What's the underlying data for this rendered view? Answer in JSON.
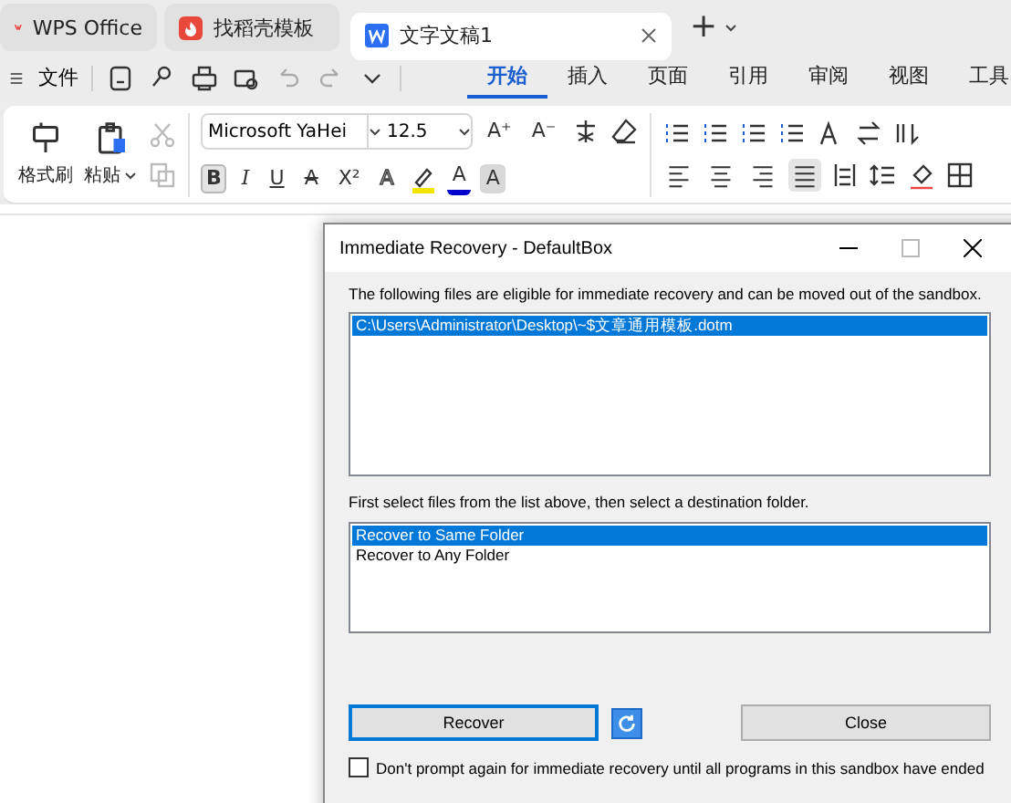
{
  "app_tabs": [
    {
      "label": "WPS Office",
      "kind": "home",
      "selected": false
    },
    {
      "label": "找稻壳模板",
      "kind": "template",
      "selected": false
    },
    {
      "label": "文字文稿1",
      "kind": "doc",
      "selected": true
    }
  ],
  "new_tab": "+",
  "file_menu": "文件",
  "menu_tabs": [
    {
      "label": "开始",
      "selected": true
    },
    {
      "label": "插入",
      "selected": false
    },
    {
      "label": "页面",
      "selected": false
    },
    {
      "label": "引用",
      "selected": false
    },
    {
      "label": "审阅",
      "selected": false
    },
    {
      "label": "视图",
      "selected": false
    },
    {
      "label": "工具",
      "selected": false
    }
  ],
  "ribbon": {
    "format_painter": "格式刷",
    "paste": "粘贴",
    "font_name": "Microsoft YaHei",
    "font_size": "12.5",
    "size_buttons": [
      "A⁺",
      "A⁻"
    ],
    "format_buttons": [
      {
        "glyph": "B",
        "kind": "bold",
        "pressed": true
      },
      {
        "glyph": "I",
        "kind": "italic",
        "pressed": false
      },
      {
        "glyph": "U",
        "kind": "underline",
        "pressed": false
      },
      {
        "glyph": "A",
        "kind": "strike",
        "pressed": false
      },
      {
        "glyph": "X²",
        "kind": "plain",
        "pressed": false
      },
      {
        "glyph": "A",
        "kind": "outline",
        "pressed": false
      },
      {
        "glyph": "A",
        "kind": "color",
        "pressed": false,
        "color": "#0000cc"
      },
      {
        "glyph": "A",
        "kind": "shade",
        "pressed": false
      }
    ],
    "align_buttons": [
      {
        "selected": false
      },
      {
        "selected": false
      },
      {
        "selected": false
      },
      {
        "selected": true
      }
    ]
  },
  "dialog": {
    "title": "Immediate Recovery - DefaultBox",
    "intro": "The following files are eligible for immediate recovery and can be moved out of the sandbox.",
    "files": [
      {
        "path": "C:\\Users\\Administrator\\Desktop\\~$文章通用模板.dotm",
        "selected": true
      }
    ],
    "hint": "First select files from the list above, then select a destination folder.",
    "targets": [
      {
        "label": "Recover to Same Folder",
        "selected": true
      },
      {
        "label": "Recover to Any Folder",
        "selected": false
      }
    ],
    "recover_button": "Recover",
    "close_button": "Close",
    "dont_prompt": {
      "label": "Don't prompt again for immediate recovery until all programs in this sandbox have ended",
      "checked": false
    }
  }
}
